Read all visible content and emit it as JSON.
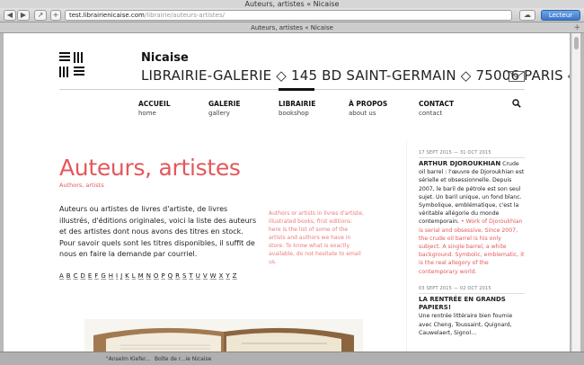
{
  "window": {
    "title": "Auteurs, artistes « Nicaise"
  },
  "toolbar": {
    "url_host": "test.librairienicaise.com",
    "url_path": "/librairie/auteurs-artistes/",
    "reader_label": "Lecteur",
    "back_glyph": "◀",
    "forward_glyph": "▶",
    "share_glyph": "↗",
    "cloud_glyph": "☁",
    "plus_glyph": "+"
  },
  "tab": {
    "label": "Auteurs, artistes « Nicaise",
    "plus_glyph": "+"
  },
  "header": {
    "site_name": "Nicaise",
    "tagline": "LIBRAIRIE-GALERIE ◇ 145 BD SAINT-GERMAIN ◇ 75006 PARIS ◇"
  },
  "nav": [
    {
      "label": "ACCUEIL",
      "sub": "home"
    },
    {
      "label": "GALERIE",
      "sub": "gallery"
    },
    {
      "label": "LIBRAIRIE",
      "sub": "bookshop"
    },
    {
      "label": "À PROPOS",
      "sub": "about us"
    },
    {
      "label": "CONTACT",
      "sub": "contact"
    }
  ],
  "main": {
    "title": "Auteurs, artistes",
    "breadcrumb": "Authors, artists",
    "intro_fr": "Auteurs ou artistes de livres d'artiste, de livres illustrés, d'éditions originales, voici la liste des auteurs et des artistes dont nous avons des titres en stock. Pour savoir quels sont les titres disponibles, il suffit de nous en faire la demande par courriel.",
    "intro_en": "Authors or artists in livres d'artiste, illustrated books, first editions: here is the list of some of the artists and authors we have in store. To know what is exactly available, do not hesitate to email us.",
    "alphabet": [
      "A",
      "B",
      "C",
      "D",
      "E",
      "F",
      "G",
      "H",
      "I",
      "J",
      "K",
      "L",
      "M",
      "N",
      "O",
      "P",
      "Q",
      "R",
      "S",
      "T",
      "U",
      "V",
      "W",
      "X",
      "Y",
      "Z"
    ]
  },
  "sidebar": {
    "posts": [
      {
        "date": "17 SEPT 2015 — 31 OCT 2015",
        "title": "ARTHUR DJOROUKHIAN",
        "text_fr": "Crude oil barrel : l'œuvre de Djoroukhian est sérielle et obsessionnelle. Depuis 2007, le baril de pétrole est son seul sujet. Un baril unique, un fond blanc. Symbolique, emblématique, c'est la véritable allégorie du monde contemporain.",
        "text_en": "• Work of Djoroukhian is serial and obsessive. Since 2007, the crude oil barrel is his only subject. A single barrel, a white background. Symbolic, emblematic, it is the real allegory of the contemporary world."
      },
      {
        "date": "03 SEPT 2015 — 02 OCT 2015",
        "title": "LA RENTRÉE EN GRANDS PAPIERS!",
        "text_fr": "Une rentrée littéraire bien fournie avec Cheng, Toussaint, Quignard, Cauwelaert, Signol…"
      }
    ]
  },
  "statusbar": {
    "tab1": "\"Anselm Kiefer...",
    "tab2": "Boîte de r...ie Nicaise"
  },
  "colors": {
    "accent": "#e4575b",
    "reader": "#3c78c9"
  }
}
